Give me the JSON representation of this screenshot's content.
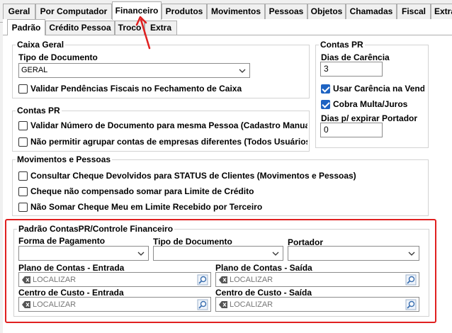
{
  "top_tabs": [
    {
      "label": "Geral"
    },
    {
      "label": "Por Computador"
    },
    {
      "label": "Financeiro"
    },
    {
      "label": "Produtos"
    },
    {
      "label": "Movimentos"
    },
    {
      "label": "Pessoas"
    },
    {
      "label": "Objetos"
    },
    {
      "label": "Chamadas"
    },
    {
      "label": "Fiscal"
    },
    {
      "label": "Extra"
    }
  ],
  "active_top_tab": "Financeiro",
  "sub_tabs": [
    {
      "label": "Padrão"
    },
    {
      "label": "Crédito Pessoa"
    },
    {
      "label": "Troco"
    },
    {
      "label": "Extra"
    }
  ],
  "active_sub_tab": "Padrão",
  "caixa_geral": {
    "title": "Caixa Geral",
    "tipo_documento_label": "Tipo de Documento",
    "tipo_documento_value": "GERAL",
    "validar_pendencias": {
      "label": "Validar Pendências Fiscais no Fechamento de Caixa",
      "checked": false
    }
  },
  "contas_pr_right": {
    "title": "Contas PR",
    "dias_carencia_label": "Dias de Carência",
    "dias_carencia_value": "3",
    "usar_carencia": {
      "label": "Usar Carência na Vend",
      "checked": true
    },
    "cobra_multa": {
      "label": "Cobra Multa/Juros",
      "checked": true
    },
    "dias_expirar_label": "Dias p/ expirar Portador",
    "dias_expirar_value": "0"
  },
  "contas_pr_left": {
    "title": "Contas PR",
    "validar_numero": {
      "label": "Validar Número de Documento para mesma Pessoa (Cadastro Manual",
      "checked": false
    },
    "nao_permitir": {
      "label": "Não permitir agrupar contas de empresas diferentes (Todos Usuários",
      "checked": false
    }
  },
  "movimentos_pessoas": {
    "title": "Movimentos e Pessoas",
    "consultar_cheque": {
      "label": "Consultar Cheque Devolvidos para STATUS de Clientes (Movimentos e Pessoas)",
      "checked": false
    },
    "cheque_nao_compensado": {
      "label": "Cheque não compensado somar para Limite de Crédito",
      "checked": false
    },
    "nao_somar_cheque": {
      "label": "Não Somar Cheque Meu em Limite Recebido por Terceiro",
      "checked": false
    }
  },
  "padrao_contas": {
    "title": "Padrão ContasPR/Controle Financeiro",
    "forma_pagamento_label": "Forma de Pagamento",
    "tipo_documento_label": "Tipo de Documento",
    "portador_label": "Portador",
    "plano_entrada_label": "Plano de Contas - Entrada",
    "plano_saida_label": "Plano de Contas - Saída",
    "centro_entrada_label": "Centro de Custo - Entrada",
    "centro_saida_label": "Centro de Custo - Saída",
    "lookup_placeholder": "LOCALIZAR"
  },
  "colors": {
    "highlight": "#e02020",
    "check_accent": "#1e63c2"
  },
  "icons": {
    "dropdown": "chevron-down-icon",
    "clear": "clear-icon",
    "search": "magnifier-icon"
  }
}
